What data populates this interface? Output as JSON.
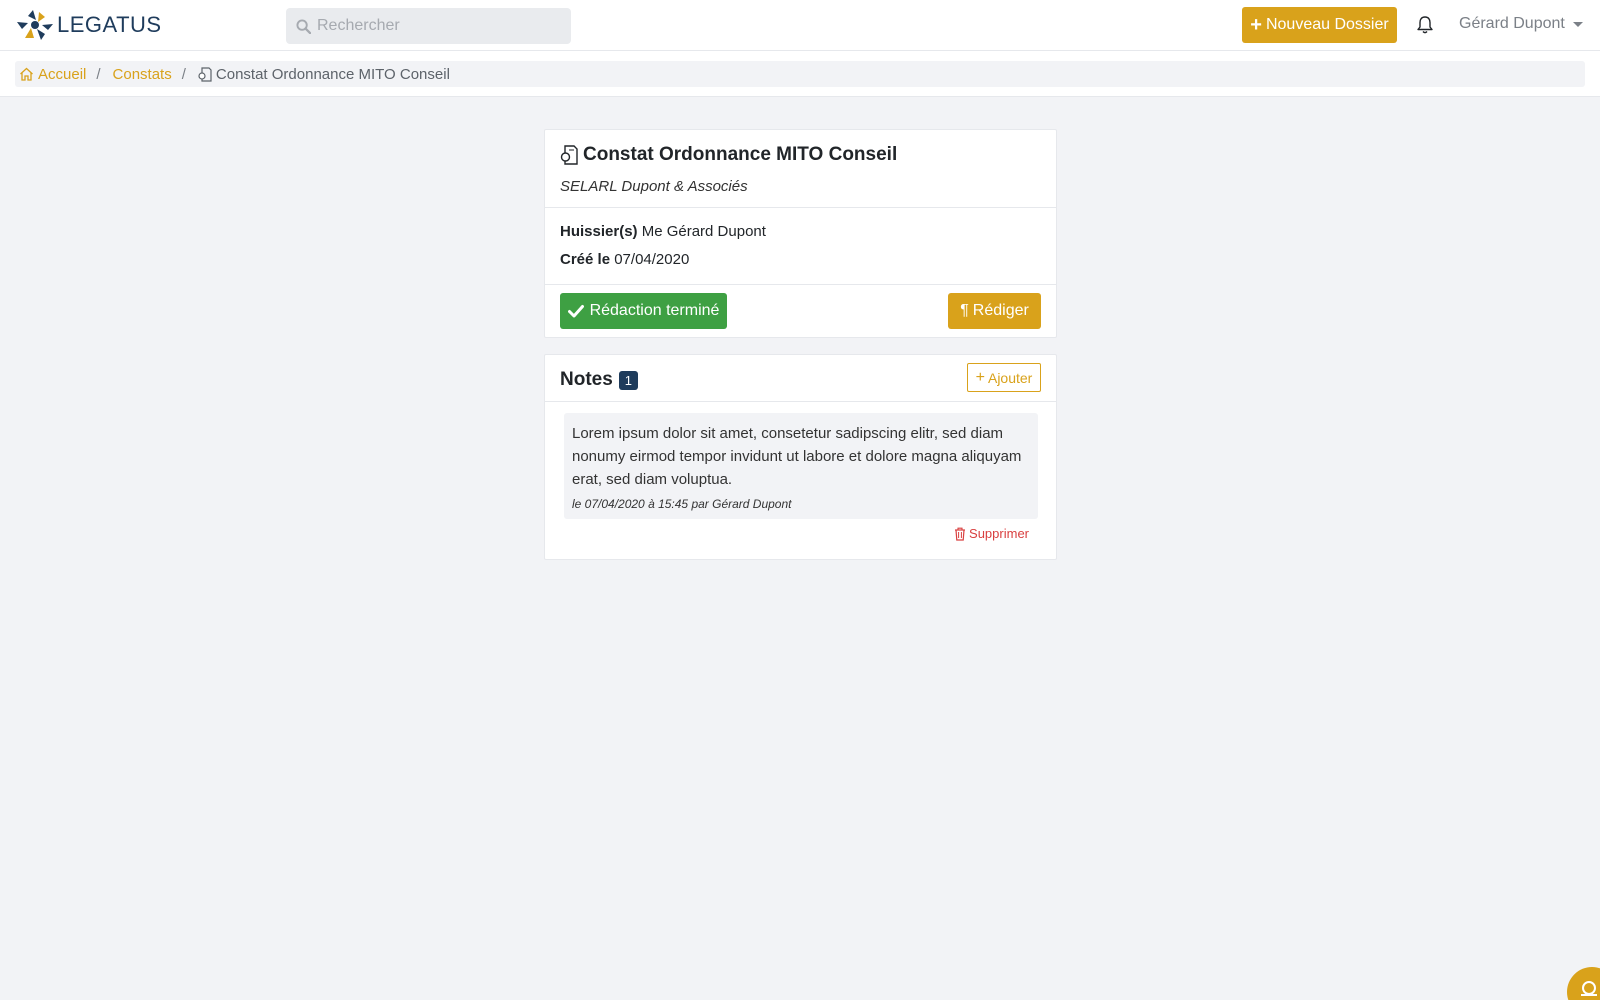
{
  "app": {
    "brand": "LEGATUS",
    "brand_color": "#1f3c5c",
    "accent_color": "#d9a21b"
  },
  "navbar": {
    "search_placeholder": "Rechercher",
    "new_button_label": "Nouveau Dossier",
    "user_name": "Gérard Dupont"
  },
  "breadcrumb": {
    "items": [
      {
        "label": "Accueil",
        "icon": "home-icon"
      },
      {
        "label": "Constats"
      },
      {
        "label": "Constat Ordonnance MITO Conseil",
        "icon": "document-icon"
      }
    ]
  },
  "dossier": {
    "title": "Constat Ordonnance MITO Conseil",
    "company": "SELARL Dupont & Associés",
    "huissiers_label": "Huissier(s)",
    "huissiers_value": "Me Gérard Dupont",
    "created_label": "Créé le",
    "created_value": "07/04/2020",
    "done_button_label": "Rédaction terminé",
    "write_button_label": "Rédiger"
  },
  "notes": {
    "title": "Notes",
    "count": "1",
    "add_button_label": "Ajouter",
    "items": [
      {
        "text": "Lorem ipsum dolor sit amet, consetetur sadipscing elitr, sed diam nonumy eirmod tempor invidunt ut labore et dolore magna aliquyam erat, sed diam voluptua.",
        "meta": "le 07/04/2020 à 15:45 par Gérard Dupont",
        "delete_label": "Supprimer"
      }
    ]
  }
}
